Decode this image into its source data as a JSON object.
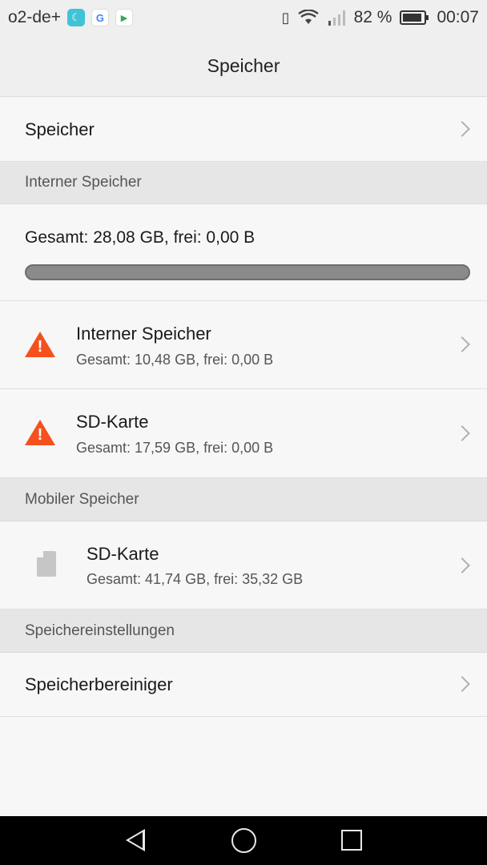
{
  "status_bar": {
    "carrier": "o2-de+",
    "battery_percent": "82 %",
    "time": "00:07",
    "icons": [
      "moon-app-icon",
      "google-icon",
      "play-store-icon",
      "vibrate-icon",
      "wifi-icon",
      "signal-icon",
      "battery-icon"
    ]
  },
  "header": {
    "title": "Speicher"
  },
  "rows": {
    "storage": {
      "label": "Speicher"
    },
    "internal_section": {
      "label": "Interner Speicher"
    },
    "total": {
      "label": "Gesamt: 28,08 GB, frei: 0,00 B",
      "used_fraction": 1.0
    },
    "internal": {
      "title": "Interner Speicher",
      "subtitle": "Gesamt: 10,48 GB, frei: 0,00 B"
    },
    "sd_internal": {
      "title": "SD-Karte",
      "subtitle": "Gesamt: 17,59 GB, frei: 0,00 B"
    },
    "mobile_section": {
      "label": "Mobiler Speicher"
    },
    "sd_mobile": {
      "title": "SD-Karte",
      "subtitle": "Gesamt: 41,74 GB, frei: 35,32 GB"
    },
    "settings_section": {
      "label": "Speichereinstellungen"
    },
    "cleaner": {
      "title": "Speicherbereiniger"
    }
  },
  "colors": {
    "warning": "#f4511e",
    "progress": "#8a8a8a",
    "navbar": "#000000"
  }
}
